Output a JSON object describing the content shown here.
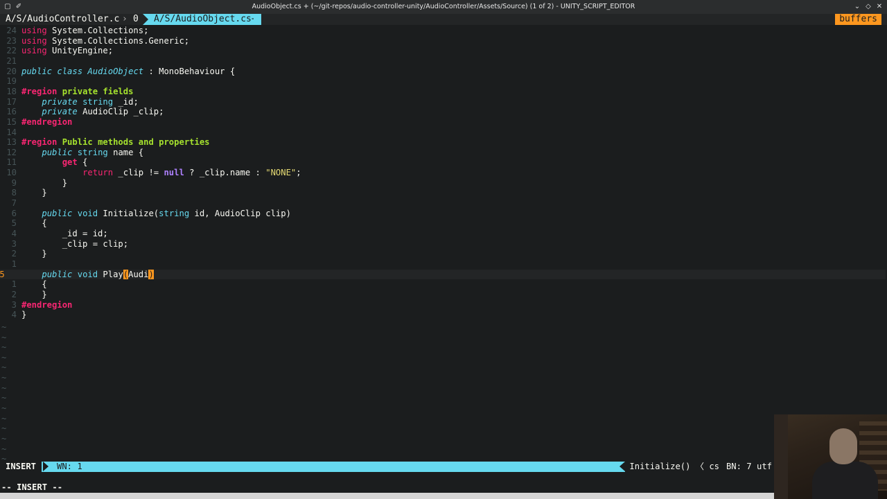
{
  "window": {
    "title": "AudioObject.cs + (~/git-repos/audio-controller-unity/AudioController/Assets/Source) (1 of 2) - UNITY_SCRIPT_EDITOR"
  },
  "tabline": {
    "tab1": "A/S/AudioController.cs",
    "sep": "0",
    "tab2": "A/S/AudioObject.cs+",
    "buffers": "buffers"
  },
  "lines": [
    {
      "num": "24",
      "html": "<span class='kw'>using</span> System.Collections;"
    },
    {
      "num": "23",
      "html": "<span class='kw'>using</span> System.Collections.Generic;"
    },
    {
      "num": "22",
      "html": "<span class='kw'>using</span> UnityEngine;"
    },
    {
      "num": "21",
      "html": ""
    },
    {
      "num": "20",
      "html": "<span class='sto'>public</span> <span class='sto'>class</span> <span class='cls'>AudioObject</span> : MonoBehaviour {"
    },
    {
      "num": "19",
      "html": ""
    },
    {
      "num": "18",
      "html": "<span class='pp'>#region</span> <span class='ppt'>private fields</span>"
    },
    {
      "num": "17",
      "html": "    <span class='sto'>private</span> <span class='typ'>string</span> _id;"
    },
    {
      "num": "16",
      "html": "    <span class='sto'>private</span> AudioClip _clip;"
    },
    {
      "num": "15",
      "html": "<span class='pp'>#endregion</span>"
    },
    {
      "num": "14",
      "html": ""
    },
    {
      "num": "13",
      "html": "<span class='pp'>#region</span> <span class='ppt'>Public methods and properties</span>"
    },
    {
      "num": "12",
      "html": "    <span class='sto'>public</span> <span class='typ'>string</span> name {"
    },
    {
      "num": "11",
      "html": "        <span class='kwb'>get</span> {"
    },
    {
      "num": "10",
      "html": "            <span class='kw'>return</span> _clip != <span class='con'>null</span> ? _clip.name : <span class='str'>\"NONE\"</span>;"
    },
    {
      "num": "9",
      "html": "        }"
    },
    {
      "num": "8",
      "html": "    }"
    },
    {
      "num": "7",
      "html": ""
    },
    {
      "num": "6",
      "html": "    <span class='sto'>public</span> <span class='typ'>void</span> Initialize(<span class='typ'>string</span> id, AudioClip clip)"
    },
    {
      "num": "5",
      "html": "    {"
    },
    {
      "num": "4",
      "html": "        _id = id;"
    },
    {
      "num": "3",
      "html": "        _clip = clip;"
    },
    {
      "num": "2",
      "html": "    }"
    },
    {
      "num": "1",
      "html": ""
    },
    {
      "num": "25",
      "html": "    <span class='sto'>public</span> <span class='typ'>void</span> Play<span class='cursor-paren'>(</span>Audi<span class='cursor-paren'>)</span>",
      "current": true
    },
    {
      "num": "1",
      "html": "    {"
    },
    {
      "num": "2",
      "html": "    }"
    },
    {
      "num": "3",
      "html": "<span class='pp'>#endregion</span>"
    },
    {
      "num": "4",
      "html": "}"
    }
  ],
  "tilde_count": 14,
  "tilde_char": "~",
  "status": {
    "mode": "INSERT",
    "wn": "WN: 1",
    "func": "Initialize() 〈 cs",
    "bn": "BN: 7 utf"
  },
  "cmdline": "-- INSERT --",
  "colors": {
    "background": "#1b1d1e",
    "accent": "#66d9ef",
    "orange": "#fd971f",
    "keyword": "#f92672",
    "string": "#e6db74"
  }
}
